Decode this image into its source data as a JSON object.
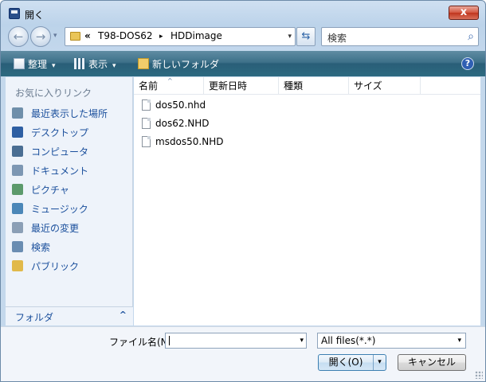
{
  "window": {
    "title": "開く",
    "close_label": "x"
  },
  "nav": {
    "back_glyph": "←",
    "forward_glyph": "→",
    "history_glyph": "▾",
    "breadcrumb_prefix": "«",
    "path": [
      {
        "label": "T98-DOS62"
      },
      {
        "label": "HDDimage"
      }
    ],
    "separator": "▸",
    "dropdown_glyph": "▾",
    "refresh_glyph": "⇆",
    "search_placeholder": "検索"
  },
  "toolbar": {
    "organize_label": "整理",
    "view_label": "表示",
    "new_folder_label": "新しいフォルダ",
    "caret": "▾",
    "help_glyph": "?"
  },
  "sidebar": {
    "favorites_header": "お気に入りリンク",
    "items": [
      {
        "label": "最近表示した場所",
        "icon": "recent-places-icon",
        "color": "#6f8faa"
      },
      {
        "label": "デスクトップ",
        "icon": "desktop-icon",
        "color": "#2e5fa3"
      },
      {
        "label": "コンピュータ",
        "icon": "computer-icon",
        "color": "#4a6e93"
      },
      {
        "label": "ドキュメント",
        "icon": "documents-icon",
        "color": "#7d97b3"
      },
      {
        "label": "ピクチャ",
        "icon": "pictures-icon",
        "color": "#5c9a6c"
      },
      {
        "label": "ミュージック",
        "icon": "music-icon",
        "color": "#4b87b8"
      },
      {
        "label": "最近の変更",
        "icon": "recently-changed-icon",
        "color": "#8b9fb6"
      },
      {
        "label": "検索",
        "icon": "search-folder-icon",
        "color": "#6a8db2"
      },
      {
        "label": "パブリック",
        "icon": "public-folder-icon",
        "color": "#e1b94a"
      }
    ],
    "folders_label": "フォルダ",
    "folders_chevron": "^"
  },
  "files": {
    "columns": [
      "名前",
      "更新日時",
      "種類",
      "サイズ"
    ],
    "sort_glyph": "^",
    "rows": [
      {
        "name": "dos50.nhd"
      },
      {
        "name": "dos62.NHD"
      },
      {
        "name": "msdos50.NHD"
      }
    ]
  },
  "footer": {
    "filename_label": "ファイル名(N):",
    "filename_value": "",
    "filetype_value": "All files(*.*)",
    "dropdown_glyph": "▾",
    "open_label": "開く(O)",
    "cancel_label": "キャンセル"
  }
}
